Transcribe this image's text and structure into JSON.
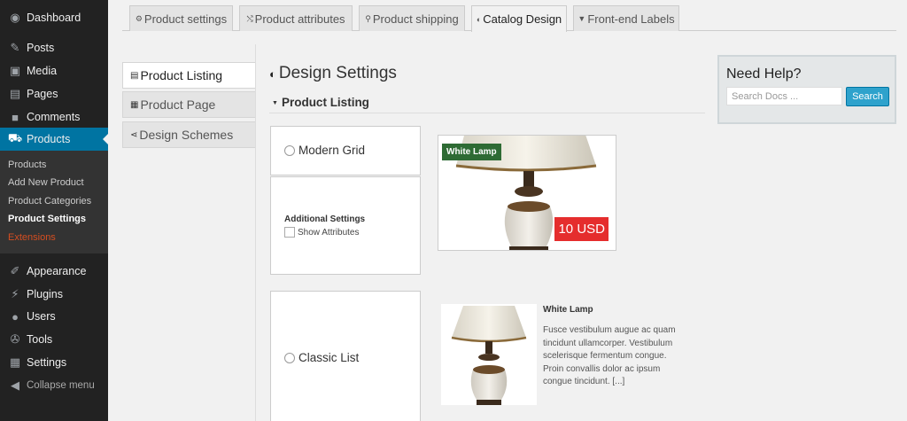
{
  "sidebar": {
    "menu": [
      {
        "label": "Dashboard",
        "icon": "dashboard-icon",
        "glyph": "◉"
      },
      {
        "label": "Posts",
        "icon": "pushpin-icon",
        "glyph": "✎"
      },
      {
        "label": "Media",
        "icon": "media-icon",
        "glyph": "▣"
      },
      {
        "label": "Pages",
        "icon": "pages-icon",
        "glyph": "▤"
      },
      {
        "label": "Comments",
        "icon": "comment-icon",
        "glyph": "■"
      },
      {
        "label": "Products",
        "icon": "cart-icon",
        "glyph": "⛟"
      }
    ],
    "submenu": [
      "Products",
      "Add New Product",
      "Product Categories",
      "Product Settings",
      "Extensions"
    ],
    "menu2": [
      {
        "label": "Appearance",
        "icon": "brush-icon",
        "glyph": "✐"
      },
      {
        "label": "Plugins",
        "icon": "plug-icon",
        "glyph": "⚡"
      },
      {
        "label": "Users",
        "icon": "user-icon",
        "glyph": "●"
      },
      {
        "label": "Tools",
        "icon": "wrench-icon",
        "glyph": "✇"
      },
      {
        "label": "Settings",
        "icon": "settings-icon",
        "glyph": "▦"
      }
    ],
    "collapse_label": "Collapse menu",
    "accent_color": "#0074a2"
  },
  "tabs": [
    {
      "label": "Product settings",
      "icon": "gear-icon",
      "glyph": "⚙"
    },
    {
      "label": "Product attributes",
      "icon": "shuffle-icon",
      "glyph": "⤭"
    },
    {
      "label": "Product shipping",
      "icon": "location-pin-icon",
      "glyph": "⚲"
    },
    {
      "label": "Catalog Design",
      "icon": "palette-icon",
      "glyph": "◐"
    },
    {
      "label": "Front-end Labels",
      "icon": "chat-bubble-icon",
      "glyph": "▼"
    }
  ],
  "subtabs": [
    {
      "label": "Product Listing",
      "icon": "list-icon",
      "glyph": "▤"
    },
    {
      "label": "Product Page",
      "icon": "page-icon",
      "glyph": "▦"
    },
    {
      "label": "Design Schemes",
      "icon": "share-icon",
      "glyph": "⋖"
    }
  ],
  "main": {
    "title": "Design Settings",
    "section": "Product Listing",
    "modern_grid_label": "Modern Grid",
    "additional_settings": "Additional Settings",
    "show_attributes": "Show Attributes",
    "classic_list_label": "Classic List"
  },
  "grid_preview": {
    "product_name": "White Lamp",
    "price": "10 USD"
  },
  "list_preview": {
    "product_name": "White Lamp",
    "description": "Fusce vestibulum augue ac quam tincidunt ullamcorper. Vestibulum scelerisque fermentum congue. Proin convallis dolor ac ipsum congue tincidunt. [...]"
  },
  "help": {
    "title": "Need Help?",
    "search_placeholder": "Search Docs ...",
    "search_button": "Search"
  }
}
